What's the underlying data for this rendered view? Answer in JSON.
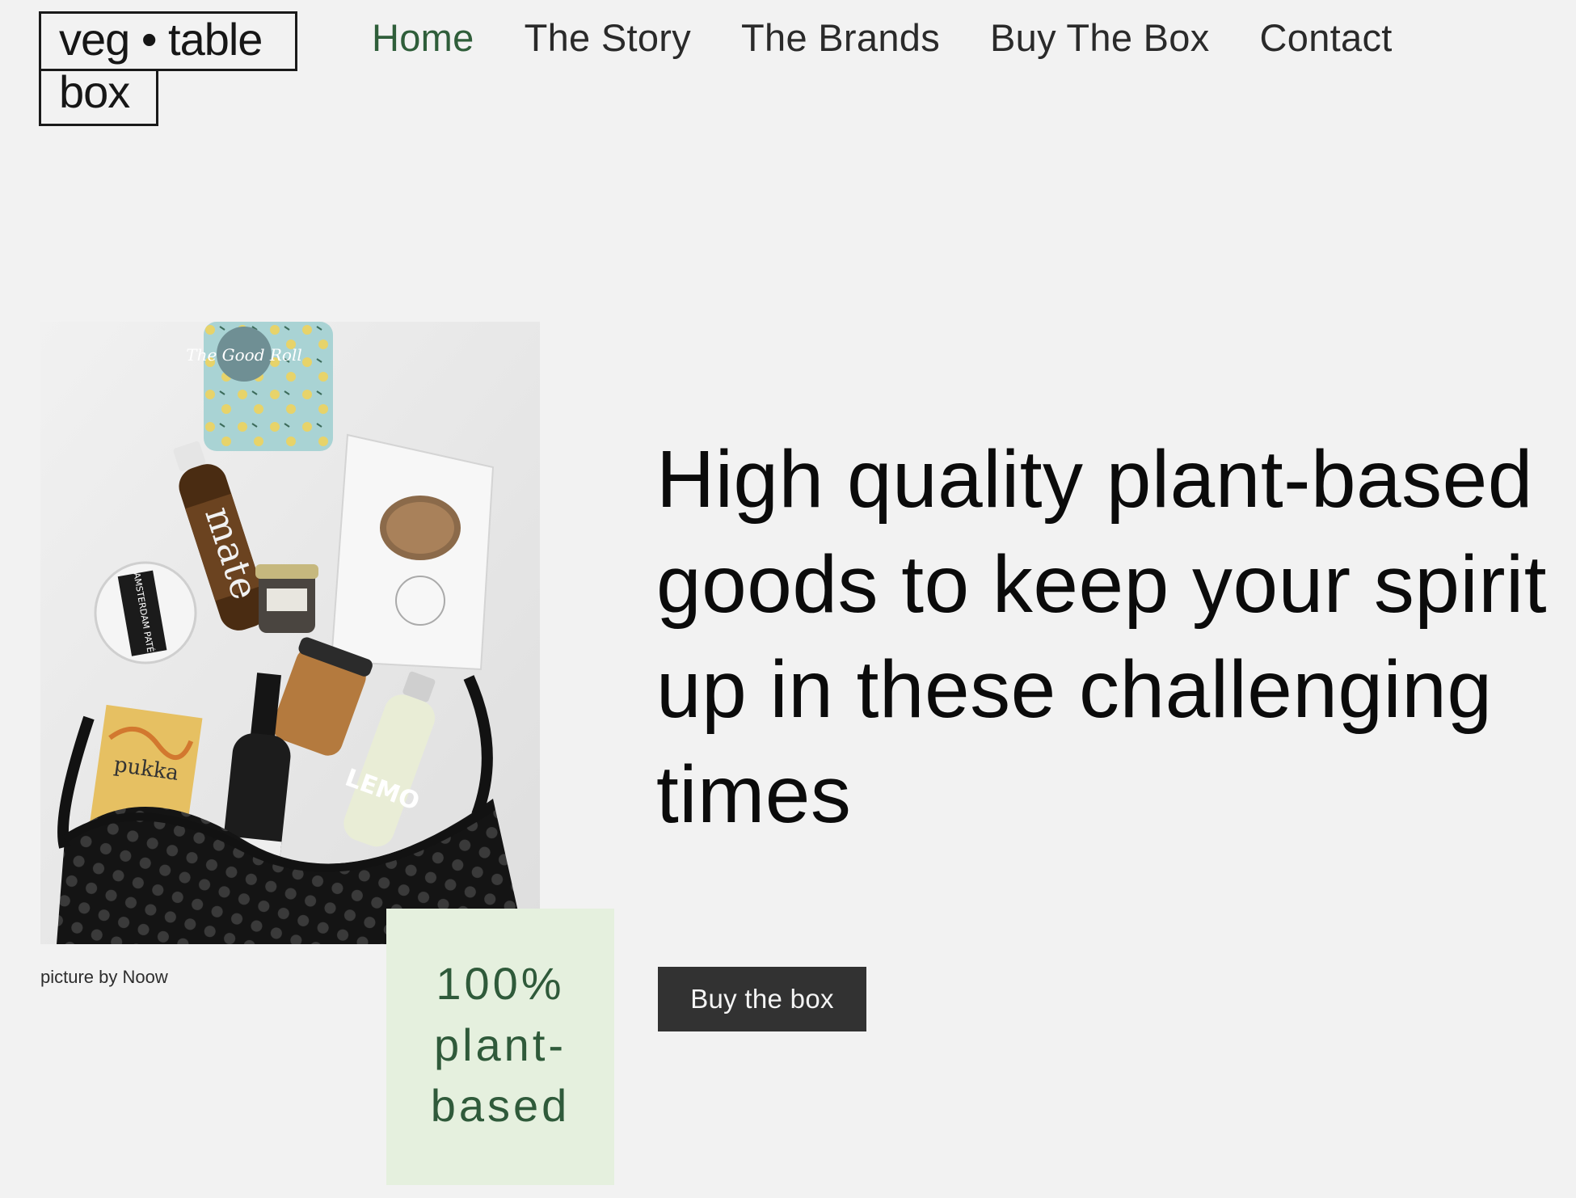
{
  "logo": {
    "line1": "veg • table",
    "line2": "box"
  },
  "nav": {
    "items": [
      {
        "label": "Home",
        "active": true
      },
      {
        "label": "The Story",
        "active": false
      },
      {
        "label": "The Brands",
        "active": false
      },
      {
        "label": "Buy The Box",
        "active": false
      },
      {
        "label": "Contact",
        "active": false
      }
    ]
  },
  "hero": {
    "headline_lines": [
      "High quality plant-based",
      "goods to keep your spirit",
      "up in these challenging",
      "times"
    ],
    "cta_label": "Buy the box",
    "photo_credit": "picture by Noow",
    "photo_alt_text": {
      "roll_label": "The Good Roll",
      "bottle_label": "mate",
      "pate_label": "AMSTERDAM PATÉ",
      "tea_label": "pukka",
      "lemon_label": "LEMO"
    }
  },
  "badge": {
    "lines": [
      "100%",
      "plant-",
      "based"
    ]
  },
  "colors": {
    "background": "#f2f2f2",
    "nav_active": "#2f5e3a",
    "badge_bg": "#e5f0de",
    "badge_text": "#2f5a3a",
    "cta_bg": "#323232"
  }
}
